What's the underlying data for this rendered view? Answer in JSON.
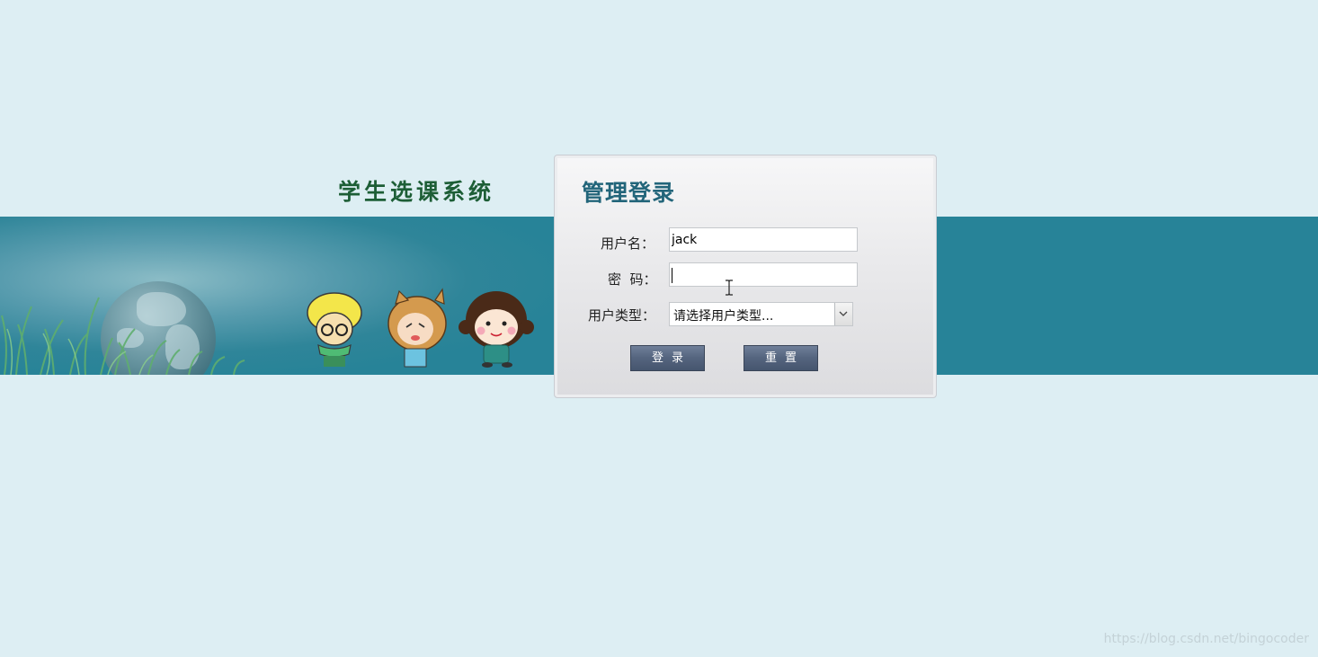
{
  "app": {
    "title": "学生选课系统"
  },
  "login": {
    "title": "管理登录",
    "username_label": "用户名：",
    "username_value": "jack",
    "password_label": "密  码：",
    "password_value": "",
    "usertype_label": "用户类型：",
    "usertype_selected": "请选择用户类型...",
    "login_button": "登录",
    "reset_button": "重置"
  },
  "watermark": "https://blog.csdn.net/bingocoder",
  "colors": {
    "background": "#ddeef3",
    "banner": "#278398",
    "title_green": "#1d5e36",
    "panel_title": "#22657a",
    "button": "#54647e"
  }
}
